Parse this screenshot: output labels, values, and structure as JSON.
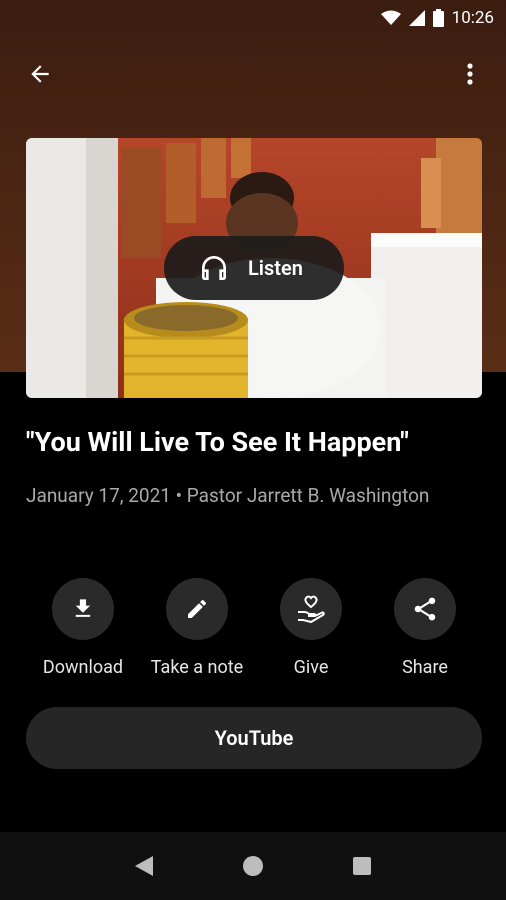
{
  "status_bar": {
    "time": "10:26",
    "icons": [
      "wifi-icon",
      "cell-signal-icon",
      "battery-icon"
    ]
  },
  "toolbar": {
    "back_icon": "back-arrow-icon",
    "menu_icon": "more-vert-icon"
  },
  "hero": {
    "listen_label": "Listen",
    "listen_icon": "headphones-icon"
  },
  "sermon": {
    "title": "\"You Will Live To See It Happen\"",
    "meta": "January 17, 2021 • Pastor Jarrett B. Washington"
  },
  "actions": [
    {
      "label": "Download",
      "icon": "download-icon"
    },
    {
      "label": "Take a note",
      "icon": "pencil-icon"
    },
    {
      "label": "Give",
      "icon": "give-hand-heart-icon"
    },
    {
      "label": "Share",
      "icon": "share-icon"
    }
  ],
  "youtube": {
    "label": "YouTube"
  },
  "nav": {
    "icons": [
      "nav-back-icon",
      "nav-home-icon",
      "nav-recents-icon"
    ]
  },
  "colors": {
    "header_bg": "#4c2613",
    "surface": "#000000",
    "chip": "#2a2a2a",
    "muted_text": "#a9a9a9"
  }
}
